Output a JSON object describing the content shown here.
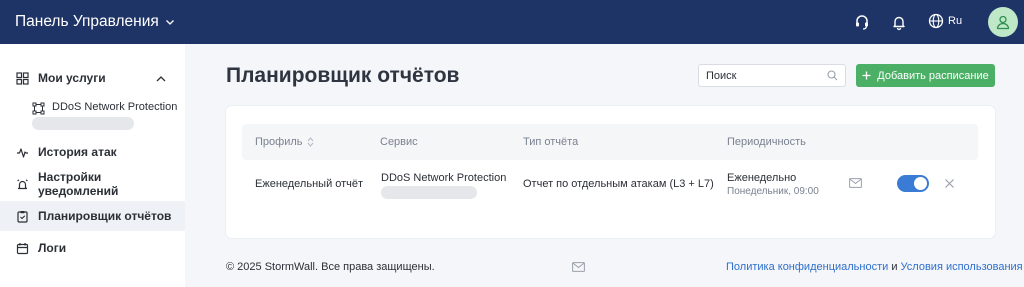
{
  "topbar": {
    "title": "Панель Управления",
    "language": "Ru",
    "icons": [
      "chevron-down-icon",
      "headset-icon",
      "bell-icon",
      "globe-icon",
      "user-icon"
    ]
  },
  "sidebar": {
    "items": [
      {
        "label": "Мои услуги",
        "icon": "grid-icon"
      },
      {
        "label": "История атак",
        "icon": "pulse-icon"
      },
      {
        "label": "Настройки уведомлений",
        "icon": "alarm-icon"
      },
      {
        "label": "Планировщик отчётов",
        "icon": "clipboard-icon",
        "active": true
      },
      {
        "label": "Логи",
        "icon": "calendar-icon"
      }
    ],
    "sub_item": {
      "label": "DDoS Network Protection",
      "icon": "network-icon"
    }
  },
  "page": {
    "title": "Планировщик отчётов",
    "search_placeholder": "Поиск",
    "add_button": "Добавить расписание"
  },
  "table": {
    "headers": {
      "profile": "Профиль",
      "service": "Сервис",
      "type": "Тип отчёта",
      "period": "Периодичность"
    },
    "rows": [
      {
        "profile": "Еженедельный отчёт",
        "service": "DDoS Network Protection",
        "type": "Отчет по отдельным атакам (L3 + L7)",
        "period": "Еженедельно",
        "period_detail": "Понедельник, 09:00",
        "enabled": true
      }
    ]
  },
  "footer": {
    "copyright": "© 2025 StormWall. Все права защищены.",
    "privacy": "Политика конфиденциальности",
    "and": " и ",
    "terms": "Условия использования"
  },
  "colors": {
    "topbar": "#1f3466",
    "accent_green": "#4caf66",
    "toggle_on": "#3a7bd5",
    "link": "#2f6fcc"
  }
}
